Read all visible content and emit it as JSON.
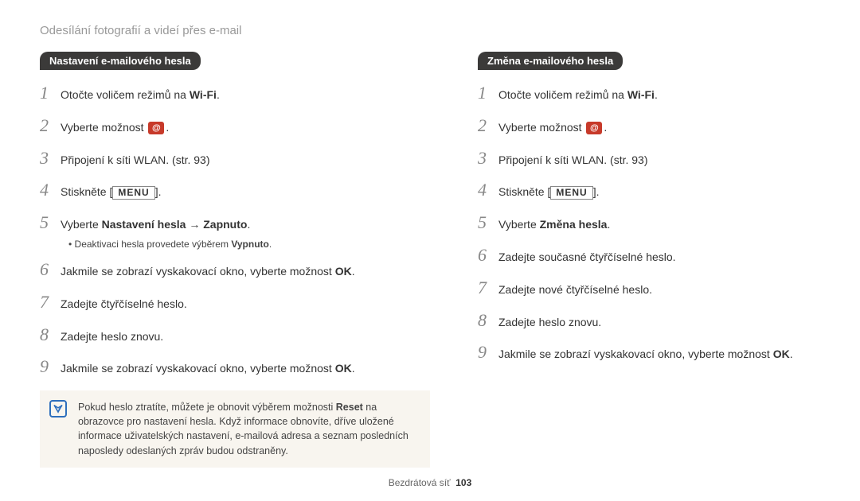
{
  "header": "Odesílání fotografií a videí přes e-mail",
  "left": {
    "badge": "Nastavení e-mailového hesla",
    "s1a": "Otočte voličem režimů na ",
    "s1b": "Wi-Fi",
    "s1c": ".",
    "s2a": "Vyberte možnost ",
    "s2c": ".",
    "s3": "Připojení k síti WLAN. (str. 93)",
    "s4a": "Stiskněte [",
    "s4menu": "MENU",
    "s4c": "].",
    "s5a": "Vyberte ",
    "s5b": "Nastavení hesla → Zapnuto",
    "s5c": ".",
    "s5sub_a": "• Deaktivaci hesla provedete výběrem ",
    "s5sub_b": "Vypnuto",
    "s5sub_c": ".",
    "s6a": "Jakmile se zobrazí vyskakovací okno, vyberte možnost ",
    "s6b": "OK",
    "s6c": ".",
    "s7": "Zadejte čtyřčíselné heslo.",
    "s8": "Zadejte heslo znovu.",
    "s9a": "Jakmile se zobrazí vyskakovací okno, vyberte možnost ",
    "s9b": "OK",
    "s9c": "."
  },
  "right": {
    "badge": "Změna e-mailového hesla",
    "s1a": "Otočte voličem režimů na ",
    "s1b": "Wi-Fi",
    "s1c": ".",
    "s2a": "Vyberte možnost ",
    "s2c": ".",
    "s3": "Připojení k síti WLAN. (str. 93)",
    "s4a": "Stiskněte [",
    "s4menu": "MENU",
    "s4c": "].",
    "s5a": "Vyberte ",
    "s5b": "Změna hesla",
    "s5c": ".",
    "s6": "Zadejte současné čtyřčíselné heslo.",
    "s7": "Zadejte nové čtyřčíselné heslo.",
    "s8": "Zadejte heslo znovu.",
    "s9a": "Jakmile se zobrazí vyskakovací okno, vyberte možnost ",
    "s9b": "OK",
    "s9c": "."
  },
  "note_a": "Pokud heslo ztratíte, můžete je obnovit výběrem možnosti ",
  "note_b": "Reset",
  "note_c": "  na obrazovce pro nastavení hesla. Když informace obnovíte, dříve uložené informace uživatelských nastavení, e-mailová adresa a seznam posledních naposledy odeslaných zpráv budou odstraněny.",
  "footer_label": "Bezdrátová síť",
  "footer_page": "103",
  "nums": {
    "n1": "1",
    "n2": "2",
    "n3": "3",
    "n4": "4",
    "n5": "5",
    "n6": "6",
    "n7": "7",
    "n8": "8",
    "n9": "9"
  }
}
